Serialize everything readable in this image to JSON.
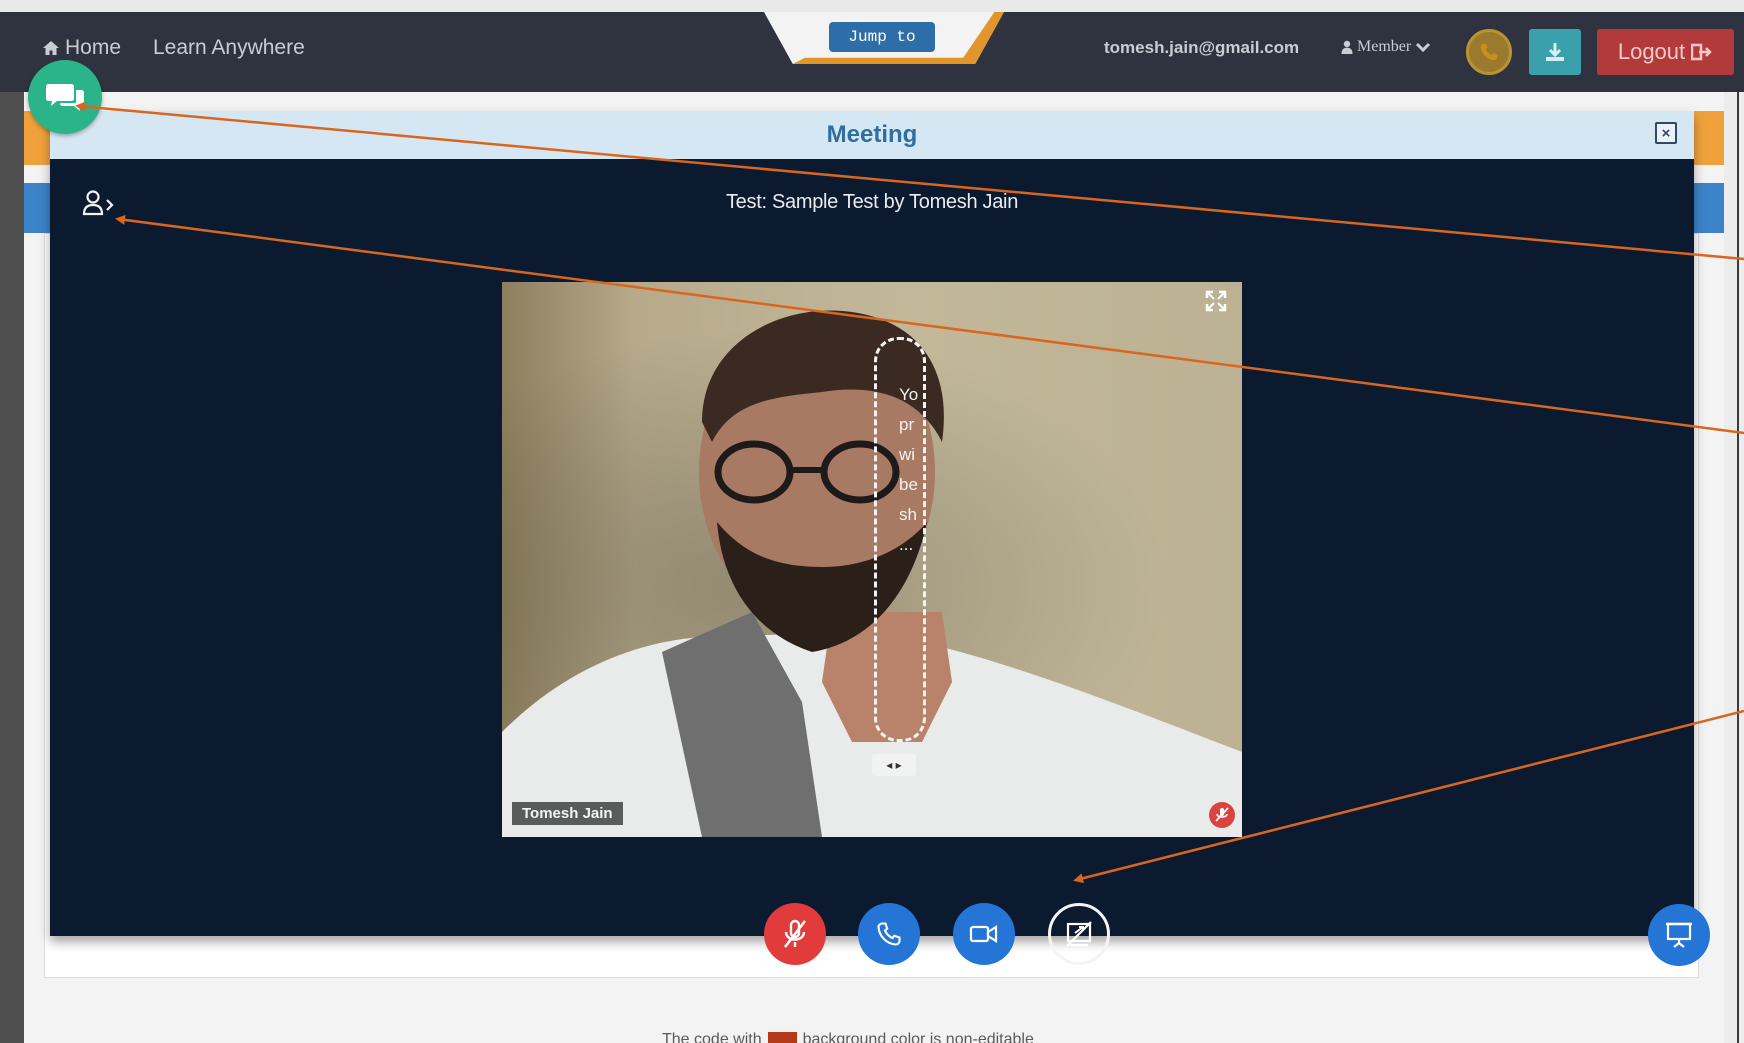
{
  "colors": {
    "navbar_bg": "#2f3340",
    "modal_bg": "#0c1a30",
    "modal_header_bg": "#d6e7f4",
    "modal_title": "#2f6f9d",
    "mute_red": "#e23b3b",
    "control_blue": "#2575d6",
    "chat_green": "#2bb38a",
    "logout_red": "#b23a3a",
    "annotation_orange": "#d9661f"
  },
  "navbar": {
    "home_icon": "home-icon",
    "home_label": "Home",
    "learn_label": "Learn Anywhere",
    "jump_label": "Jump to",
    "email": "tomesh.jain@gmail.com",
    "member_label": "Member",
    "logout_label": "Logout"
  },
  "modal": {
    "title": "Meeting",
    "close_symbol": "×",
    "meeting_title": "Test: Sample Test by Tomesh Jain"
  },
  "video": {
    "participant_name": "Tomesh Jain",
    "transcript_lines": [
      "Yo",
      "pr",
      "wi",
      "be",
      "sh",
      "..."
    ],
    "handle_symbol": "◂ ▸"
  },
  "controls": {
    "mic_icon": "mic-off-icon",
    "phone_icon": "phone-icon",
    "camera_icon": "video-camera-icon",
    "share_icon": "screen-share-off-icon",
    "present_icon": "presentation-icon"
  },
  "background": {
    "footer_before": "The code with",
    "footer_after": "background color is non-editable"
  }
}
